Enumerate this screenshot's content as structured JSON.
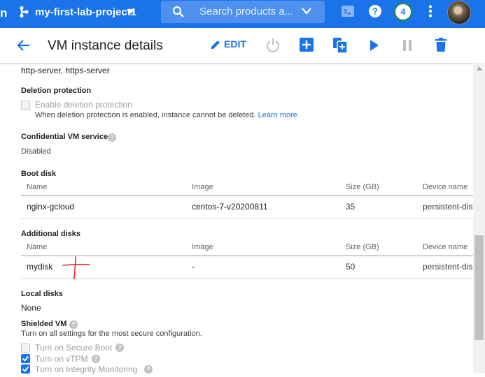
{
  "topbar": {
    "left_fragment": "n",
    "project_name": "my-first-lab-project1",
    "search_placeholder": "Search products a...",
    "notification_count": "4",
    "icons": [
      "project-hierarchy-icon",
      "chevron-down-icon",
      "search-icon",
      "cloud-shell-icon",
      "help-icon",
      "more-vert-icon"
    ]
  },
  "header": {
    "title": "VM instance details",
    "edit_label": "EDIT",
    "actions": [
      "reset-icon",
      "create-icon",
      "clone-icon",
      "start-icon",
      "stop-icon",
      "delete-icon"
    ]
  },
  "content": {
    "network_tags": "http-server, https-server",
    "deletion_protection": {
      "label": "Deletion protection",
      "checkbox_label": "Enable deletion protection",
      "description": "When deletion protection is enabled, instance cannot be deleted.",
      "learn_more": "Learn more"
    },
    "confidential": {
      "label": "Confidential VM service",
      "value": "Disabled"
    },
    "boot_disk": {
      "label": "Boot disk",
      "columns": [
        "Name",
        "Image",
        "Size (GB)",
        "Device name"
      ],
      "rows": [
        [
          "nginx-gcloud",
          "centos-7-v20200811",
          "35",
          "persistent-dis"
        ]
      ]
    },
    "additional_disks": {
      "label": "Additional disks",
      "columns": [
        "Name",
        "Image",
        "Size (GB)",
        "Device name"
      ],
      "rows": [
        [
          "mydisk",
          "-",
          "50",
          "persistent-dis"
        ]
      ]
    },
    "local_disks": {
      "label": "Local disks",
      "value": "None"
    },
    "shielded_vm": {
      "label": "Shielded VM",
      "description": "Turn on all settings for the most secure configuration.",
      "options": [
        {
          "label": "Turn on Secure Boot",
          "checked": false
        },
        {
          "label": "Turn on vTPM",
          "checked": true
        },
        {
          "label": "Turn on Integrity Monitoring",
          "checked": true
        }
      ]
    }
  },
  "colors": {
    "brand": "#1a73e8",
    "annotation": "#e8202a"
  }
}
